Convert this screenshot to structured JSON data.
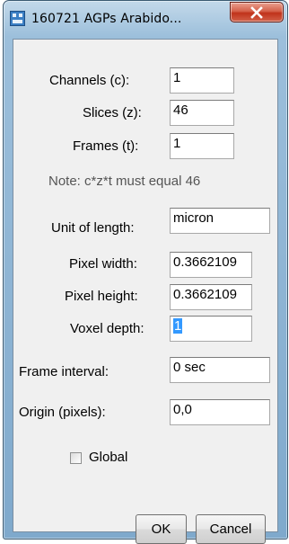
{
  "window": {
    "title": "160721 AGPs Arabido...",
    "close_symbol": "✕"
  },
  "icons": {
    "app": "imagej-app-icon",
    "close": "close-icon"
  },
  "colors": {
    "close_button": "#c0321a",
    "selection": "#3399ff",
    "titlebar": "#9cbfdb"
  },
  "fields": {
    "channels": {
      "label": "Channels (c):",
      "value": "1"
    },
    "slices": {
      "label": "Slices (z):",
      "value": "46"
    },
    "frames": {
      "label": "Frames (t):",
      "value": "1"
    },
    "note": "Note: c*z*t must equal 46",
    "unit": {
      "label": "Unit of length:",
      "value": "micron"
    },
    "pixel_width": {
      "label": "Pixel width:",
      "value": "0.3662109"
    },
    "pixel_height": {
      "label": "Pixel height:",
      "value": "0.3662109"
    },
    "voxel_depth": {
      "label": "Voxel depth:",
      "value": "1"
    },
    "frame_interval": {
      "label": "Frame interval:",
      "value": "0 sec"
    },
    "origin": {
      "label": "Origin (pixels):",
      "value": "0,0"
    }
  },
  "global_checkbox": {
    "label": "Global",
    "checked": false
  },
  "buttons": {
    "ok": "OK",
    "cancel": "Cancel"
  }
}
